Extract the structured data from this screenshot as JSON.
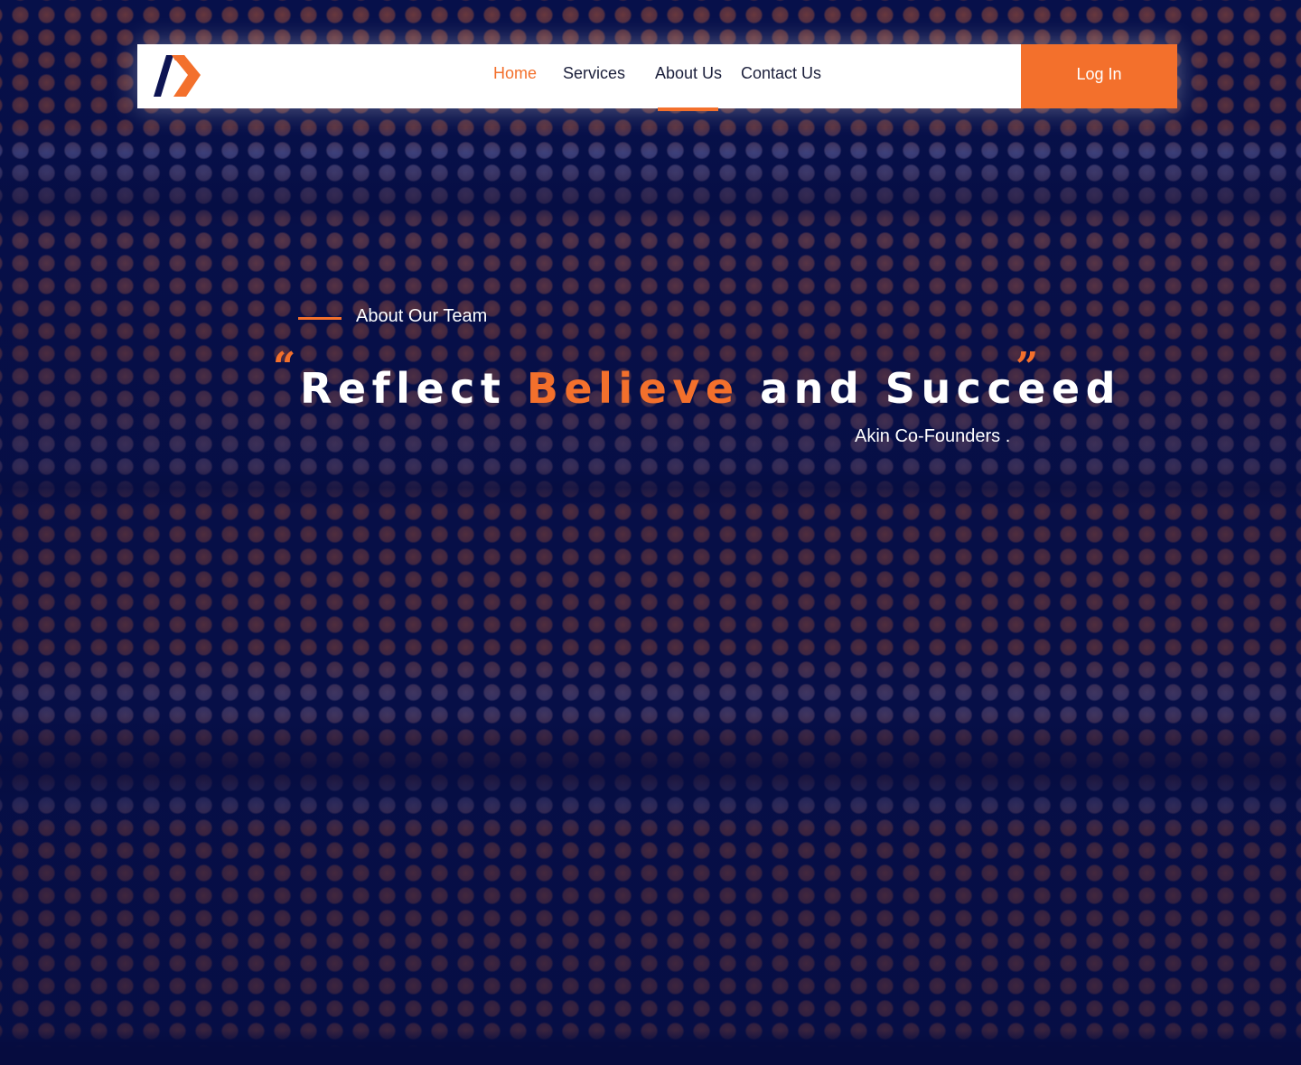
{
  "colors": {
    "accent": "#f3702c",
    "background": "#07104a",
    "nav_text": "#1b1f3b",
    "logo_dark": "#0d1453"
  },
  "header": {
    "logo_icon": "brand-chevron-logo",
    "nav": [
      {
        "label": "Home",
        "active": true
      },
      {
        "label": "Services",
        "active": false
      },
      {
        "label": "About Us",
        "active": false
      },
      {
        "label": "Contact Us",
        "active": false
      }
    ],
    "login_label": "Log In"
  },
  "hero": {
    "eyebrow": "About Our Team",
    "quote_open": "“",
    "quote_close": "”",
    "headline_part1": "Reflect ",
    "headline_accent": "Believe",
    "headline_part2": " and Succeed",
    "attribution": "Akin Co-Founders ."
  }
}
